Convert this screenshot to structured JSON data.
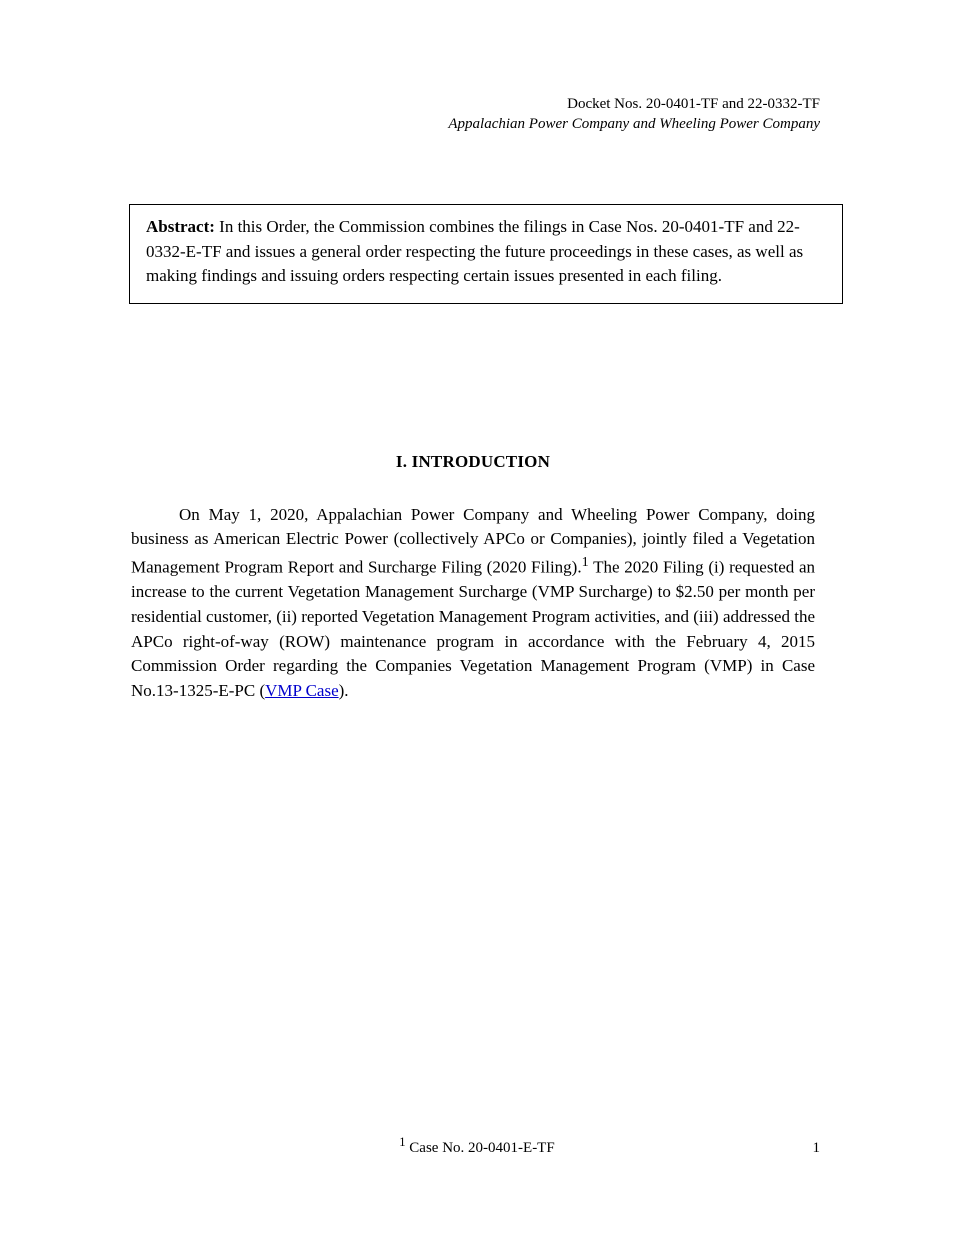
{
  "header": {
    "docket": "Docket Nos. 20-0401-TF and 22-0332-TF",
    "owner": "Appalachian Power Company and Wheeling Power Company"
  },
  "abstract": {
    "label": "Abstract:",
    "text": " In this Order, the Commission combines the filings in Case Nos. 20-0401-TF and 22-0332-E-TF and issues a general order respecting the future proceedings in these cases, as well as making findings and issuing orders respecting certain issues presented in each filing."
  },
  "section_title": "I.   INTRODUCTION",
  "paragraphs": {
    "p1_a": "On May 1, 2020, Appalachian Power Company and Wheeling Power Company, doing business as American Electric Power (collectively APCo or Companies), jointly filed a Vegetation Management Program Report and Surcharge Filing (2020 Filing).",
    "p1_ref_marker": "1",
    "p1_b": "  The 2020 Filing (i) requested an increase to the current Vegetation Management Surcharge (VMP Surcharge) to $2.50 per month per residential customer, (ii) reported Vegetation Management Program activities, and (iii) addressed the APCo right-of-way (ROW) maintenance program in accordance with the February 4, 2015 Commission Order regarding the Companies Vegetation Management Program (VMP) in Case No.13-1325-E-PC (",
    "p1_link_text": "VMP Case",
    "p1_c": ")."
  },
  "footer": {
    "ref_marker": "1",
    "ref_text": " Case No. 20-0401-E-TF",
    "page_num": "1"
  }
}
